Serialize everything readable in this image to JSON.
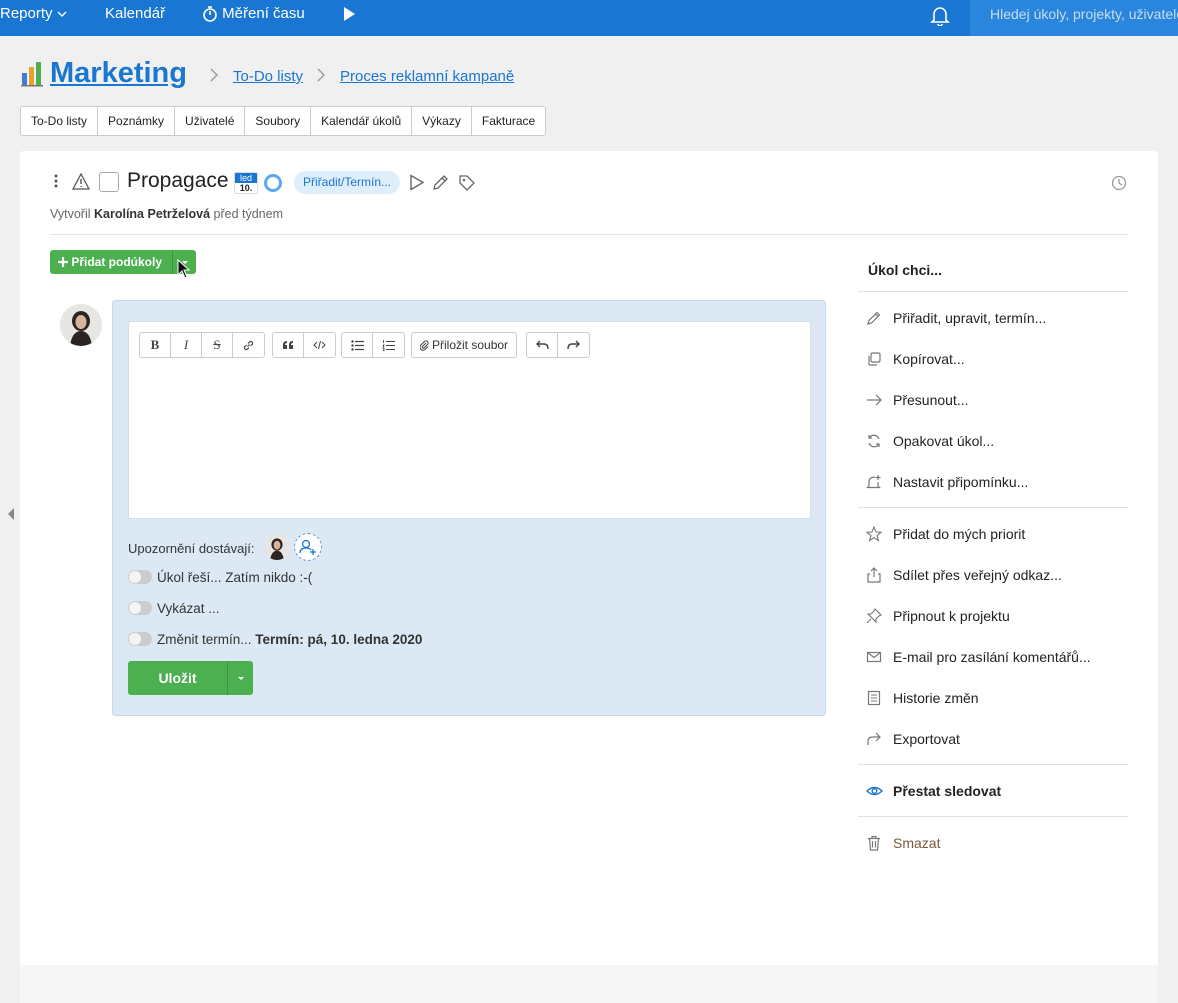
{
  "topbar": {
    "nav": [
      {
        "label": "Reporty"
      },
      {
        "label": "Kalendář"
      },
      {
        "label": "Měření času"
      }
    ],
    "search_placeholder": "Hledej úkoly, projekty, uživatele"
  },
  "header": {
    "project": "Marketing",
    "breadcrumb": [
      "To-Do listy",
      "Proces reklamní kampaně"
    ],
    "tabs": [
      "To-Do listy",
      "Poznámky",
      "Uživatelé",
      "Soubory",
      "Kalendář úkolů",
      "Výkazy",
      "Fakturace"
    ]
  },
  "task": {
    "title": "Propagace",
    "date_month": "led",
    "date_day": "10.",
    "assign_label": "Přiřadit/Termín...",
    "created_prefix": "Vytvořil",
    "created_by": "Karolína Petrželová",
    "created_when": "před týdnem"
  },
  "subtasks": {
    "add_label": "Přidat podúkoly"
  },
  "editor": {
    "attach_label": "Přiložit soubor",
    "notify_label": "Upozornění dostávají:",
    "toggles": [
      {
        "label": "Úkol řeší...",
        "value": "Zatím nikdo :-("
      },
      {
        "label": "Vykázat ...",
        "value": ""
      },
      {
        "label": "Změnit termín...",
        "value": "Termín: pá, 10. ledna 2020"
      }
    ],
    "save_label": "Uložit"
  },
  "menu": {
    "heading": "Úkol chci...",
    "items": [
      {
        "label": "Přiřadit, upravit, termín...",
        "icon": "pencil-icon"
      },
      {
        "label": "Kopírovat...",
        "icon": "copy-icon"
      },
      {
        "label": "Přesunout...",
        "icon": "arrow-right-icon"
      },
      {
        "label": "Opakovat úkol...",
        "icon": "repeat-icon"
      },
      {
        "label": "Nastavit připomínku...",
        "icon": "bell-plus-icon"
      },
      {
        "label": "Přidat do mých priorit",
        "icon": "star-icon"
      },
      {
        "label": "Sdílet přes veřejný odkaz...",
        "icon": "share-icon"
      },
      {
        "label": "Připnout k projektu",
        "icon": "pin-icon"
      },
      {
        "label": "E-mail pro zasílání komentářů...",
        "icon": "mail-icon"
      },
      {
        "label": "Historie změn",
        "icon": "history-icon"
      },
      {
        "label": "Exportovat",
        "icon": "export-icon"
      },
      {
        "label": "Přestat sledovat",
        "icon": "eye-icon"
      },
      {
        "label": "Smazat",
        "icon": "trash-icon"
      }
    ]
  },
  "colors": {
    "brand": "#1976d2",
    "success": "#4caf50",
    "panel": "#dce9f5"
  }
}
